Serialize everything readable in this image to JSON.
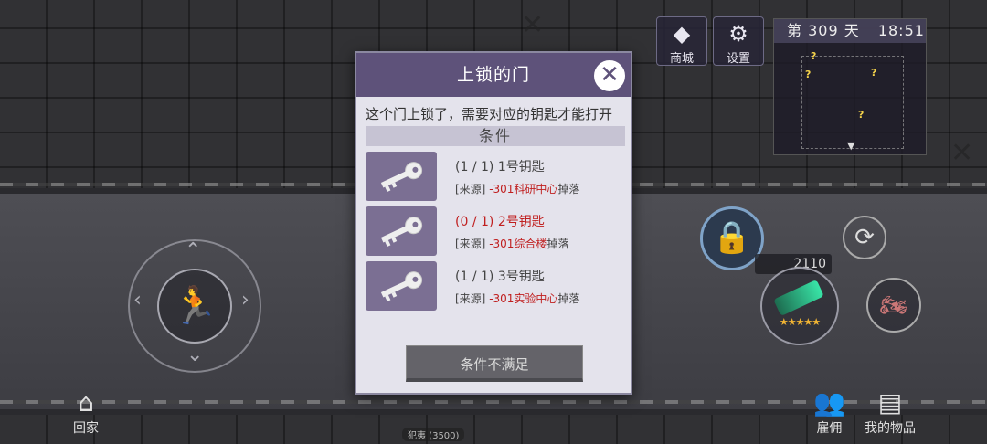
{
  "hud": {
    "shop": {
      "icon": "diamond-icon",
      "label": "商城"
    },
    "settings": {
      "icon": "gear-icon",
      "label": "设置"
    },
    "day_label": "第 309 天",
    "clock": "18:51",
    "home": {
      "icon": "house-icon",
      "label": "回家"
    },
    "hire": {
      "icon": "people-icon",
      "label": "雇佣"
    },
    "inventory": {
      "icon": "chest-icon",
      "label": "我的物品"
    },
    "ammo_count": "2110",
    "weapon_stars": 5,
    "bottom_item_label": "犯夷 (3500)"
  },
  "dialog": {
    "title": "上锁的门",
    "description": "这个门上锁了，需要对应的钥匙才能打开",
    "section_title": "条件",
    "requirements": [
      {
        "progress": "(1 / 1)",
        "name": "1号钥匙",
        "met": true,
        "source_prefix": "[来源] ",
        "source_location": "-301科研中心",
        "source_suffix": "掉落"
      },
      {
        "progress": "(0 / 1)",
        "name": "2号钥匙",
        "met": false,
        "source_prefix": "[来源] ",
        "source_location": "-301综合楼",
        "source_suffix": "掉落"
      },
      {
        "progress": "(1 / 1)",
        "name": "3号钥匙",
        "met": true,
        "source_prefix": "[来源] ",
        "source_location": "-301实验中心",
        "source_suffix": "掉落"
      }
    ],
    "submit_label": "条件不满足"
  },
  "colors": {
    "dialog_header": "#5e527a",
    "key_tile": "#7b6f93",
    "unmet_text": "#c01f1f"
  }
}
